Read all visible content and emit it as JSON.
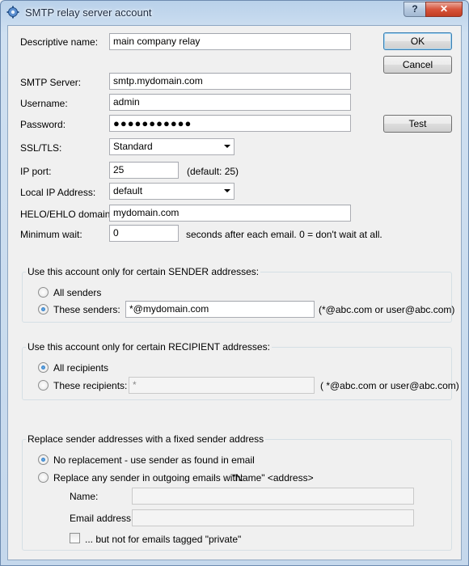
{
  "window": {
    "title": "SMTP relay server account",
    "help_label": "?",
    "close_label": "✕"
  },
  "buttons": {
    "ok": "OK",
    "cancel": "Cancel",
    "test": "Test"
  },
  "fields": {
    "descriptive_name": {
      "label": "Descriptive name:",
      "value": "main company relay"
    },
    "smtp_server": {
      "label": "SMTP Server:",
      "value": "smtp.mydomain.com"
    },
    "username": {
      "label": "Username:",
      "value": "admin"
    },
    "password": {
      "label": "Password:",
      "value": "●●●●●●●●●●●"
    },
    "ssl_tls": {
      "label": "SSL/TLS:",
      "value": "Standard"
    },
    "ip_port": {
      "label": "IP port:",
      "value": "25",
      "hint": "(default: 25)"
    },
    "local_ip": {
      "label": "Local IP Address:",
      "value": "default"
    },
    "helo": {
      "label": "HELO/EHLO domain:",
      "value": "mydomain.com"
    },
    "min_wait": {
      "label": "Minimum wait:",
      "value": "0",
      "hint": "seconds after each email. 0 = don't wait at all."
    }
  },
  "sender_group": {
    "title": "Use this account only for certain SENDER addresses:",
    "all_label": "All senders",
    "these_label": "These senders:",
    "these_value": "*@mydomain.com",
    "hint": "(*@abc.com or user@abc.com)",
    "selected": "these"
  },
  "recipient_group": {
    "title": "Use this account only for certain RECIPIENT addresses:",
    "all_label": "All recipients",
    "these_label": "These recipients:",
    "these_value": "*",
    "hint": "( *@abc.com or user@abc.com)",
    "selected": "all"
  },
  "replace_group": {
    "title": "Replace sender addresses with a fixed sender address",
    "no_replace_label": "No replacement - use sender as found in email",
    "replace_label": "Replace any sender in outgoing emails with:",
    "replace_hint": "\"Name\" <address>",
    "name_label": "Name:",
    "name_value": "",
    "email_label": "Email address:",
    "email_value": "",
    "private_label": "... but not for emails tagged \"private\"",
    "selected": "no_replacement"
  }
}
